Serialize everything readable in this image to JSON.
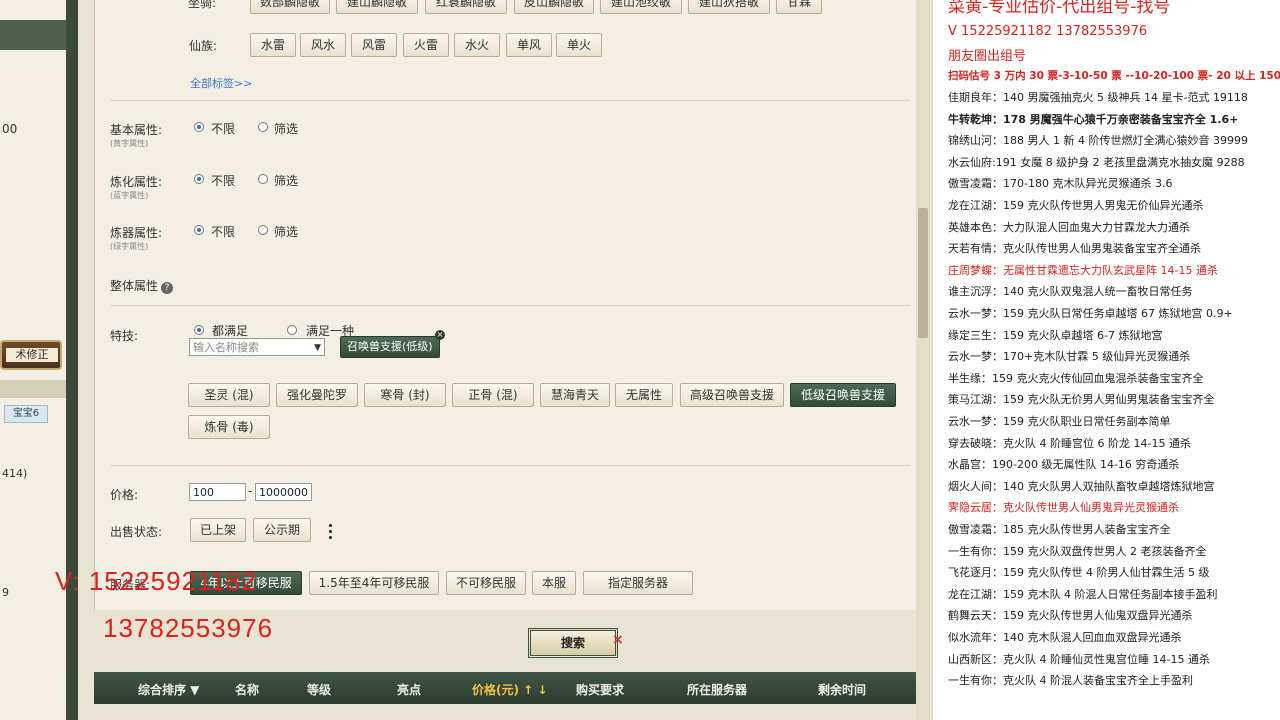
{
  "left_panel": {
    "line1": "00",
    "line2": "术修正",
    "chip": "宝宝6",
    "line3": "414)",
    "line4": "9"
  },
  "filters": {
    "top_row_label": "坐骑:",
    "top_row": [
      "数部麟隐敏",
      "建山麟隐敏",
      "红蓑麟隐敏",
      "皮山麟隐敏",
      "建山池绞敏",
      "建山狄搭敏",
      "甘霖"
    ],
    "xianzu_label": "仙族:",
    "xianzu": [
      "水雷",
      "风水",
      "风雷",
      "火雷",
      "水火",
      "单风",
      "单火"
    ],
    "all_tags": "全部标签>>",
    "attr_rows": [
      {
        "label": "基本属性:",
        "sub": "(黄字属性)",
        "opt1": "不限",
        "opt2": "筛选"
      },
      {
        "label": "炼化属性:",
        "sub": "(蓝字属性)",
        "opt1": "不限",
        "opt2": "筛选"
      },
      {
        "label": "炼器属性:",
        "sub": "(绿字属性)",
        "opt1": "不限",
        "opt2": "筛选"
      }
    ],
    "overall_label": "整体属性",
    "help_icon": "?",
    "skills_label": "特技:",
    "skills_all": "都满足",
    "skills_any": "满足一种",
    "skills_placeholder": "输入名称搜索",
    "skills_selected_tag": "召唤兽支援(低级)",
    "skill_buttons": [
      "圣灵 (混)",
      "强化曼陀罗",
      "寒骨 (封)",
      "正骨 (混)",
      "慧海青天",
      "无属性",
      "高级召唤兽支援",
      "低级召唤兽支援"
    ],
    "skill_buttons_row2": [
      "炼骨 (毒)"
    ],
    "price_label": "价格:",
    "price_min": "100",
    "price_sep": "-",
    "price_max": "1000000",
    "status_label": "出售状态:",
    "status_buttons": [
      "已上架",
      "公示期"
    ],
    "server_label": "服务器:",
    "server_buttons": [
      "4年以上可移民服",
      "1.5年至4年可移民服",
      "不可移民服",
      "本服",
      "指定服务器"
    ],
    "search_label": "搜索",
    "close_mark": "×"
  },
  "overlay": {
    "line1": "V:  15225921182",
    "line2": "13782553976"
  },
  "table_headers": [
    "综合排序 ▼",
    "名称",
    "等级",
    "亮点",
    "价格(元) ↑ ↓",
    "购买要求",
    "所在服务器",
    "剩余时间"
  ],
  "right_panel": {
    "title": "菜黄-专业估价-代出组号-找号",
    "contact": "V   15225921182   13782553976",
    "moments": "朋友圈出组号",
    "pricing": "扫码估号 3 万内 30 票-3-10-50 票 --10-20-100 票- 20 以上 150",
    "lines": [
      {
        "t": "佳期良年：140 男魔强抽克火 5 级神兵 14 星卡-范式 19118",
        "c": "n"
      },
      {
        "t": "牛转乾坤：178 男魔强牛心猿千万亲密装备宝宝齐全 1.6+",
        "c": "b"
      },
      {
        "t": "锦绣山河：188 男人 1 新 4 阶传世燃灯全满心猿妙音 39999",
        "c": "n"
      },
      {
        "t": "水云仙府:191 女魔 8 级护身 2 老孩里盘满克水抽女魔 9288",
        "c": "n"
      },
      {
        "t": "傲雪凌霜：170-180 克木队异光灵猴通杀 3.6",
        "c": "n"
      },
      {
        "t": "龙在江湖：159 克火队传世男人男鬼无价仙异光通杀",
        "c": "n"
      },
      {
        "t": "英雄本色：大力队混人回血鬼大力甘霖龙大力通杀",
        "c": "n"
      },
      {
        "t": "天若有情：克火队传世男人仙男鬼装备宝宝齐全通杀",
        "c": "n"
      },
      {
        "t": "庄周梦蝶：无属性甘霖遗忘大力队玄武星阵 14-15 通杀",
        "c": "r"
      },
      {
        "t": "谁主沉浮：140 克火队双鬼混人统一畜牧日常任务",
        "c": "n"
      },
      {
        "t": "云水一梦：159 克火队日常任务卓越塔 67 炼狱地宫 0.9+",
        "c": "n"
      },
      {
        "t": "缘定三生：159 克火队卓越塔 6-7 炼狱地宫",
        "c": "n"
      },
      {
        "t": "云水一梦：170+克木队甘霖 5 级仙异光灵猴通杀",
        "c": "n"
      },
      {
        "t": "半生缘：159 克火克火传仙回血鬼混杀装备宝宝齐全",
        "c": "n"
      },
      {
        "t": "策马江湖：159 克火队无价男人男仙男鬼装备宝宝齐全",
        "c": "n"
      },
      {
        "t": "云水一梦：159 克火队职业日常任务副本简单",
        "c": "n"
      },
      {
        "t": "穿去破晓：克火队 4 阶睡宫位 6 阶龙 14-15 通杀",
        "c": "n"
      },
      {
        "t": "水晶宫：190-200 级无属性队 14-16 穷奇通杀",
        "c": "n"
      },
      {
        "t": "烟火人间：140 克火队男人双抽队畜牧卓越塔炼狱地宫",
        "c": "n"
      },
      {
        "t": "霁隐云居：克火队传世男人仙男鬼异光灵猴通杀",
        "c": "r"
      },
      {
        "t": "傲雪凌霜：185 克火队传世男人装备宝宝齐全",
        "c": "n"
      },
      {
        "t": "一生有你：159 克火队双盘传世男人 2 老孩装备齐全",
        "c": "n"
      },
      {
        "t": "飞花逐月：159 克火队传世 4 阶男人仙甘霖生活 5 级",
        "c": "n"
      },
      {
        "t": "龙在江湖：159 克木队 4 阶混人日常任务副本接手盈利",
        "c": "n"
      },
      {
        "t": "鹤舞云天：159 克火队传世男人仙鬼双盘异光通杀",
        "c": "n"
      },
      {
        "t": "似水流年：140 克木队混人回血血双盘异光通杀",
        "c": "n"
      },
      {
        "t": "山西新区：克火队 4 阶睡仙灵性鬼宫位睡 14-15 通杀",
        "c": "n"
      },
      {
        "t": "一生有你：克火队 4 阶混人装备宝宝齐全上手盈利",
        "c": "n"
      }
    ]
  }
}
